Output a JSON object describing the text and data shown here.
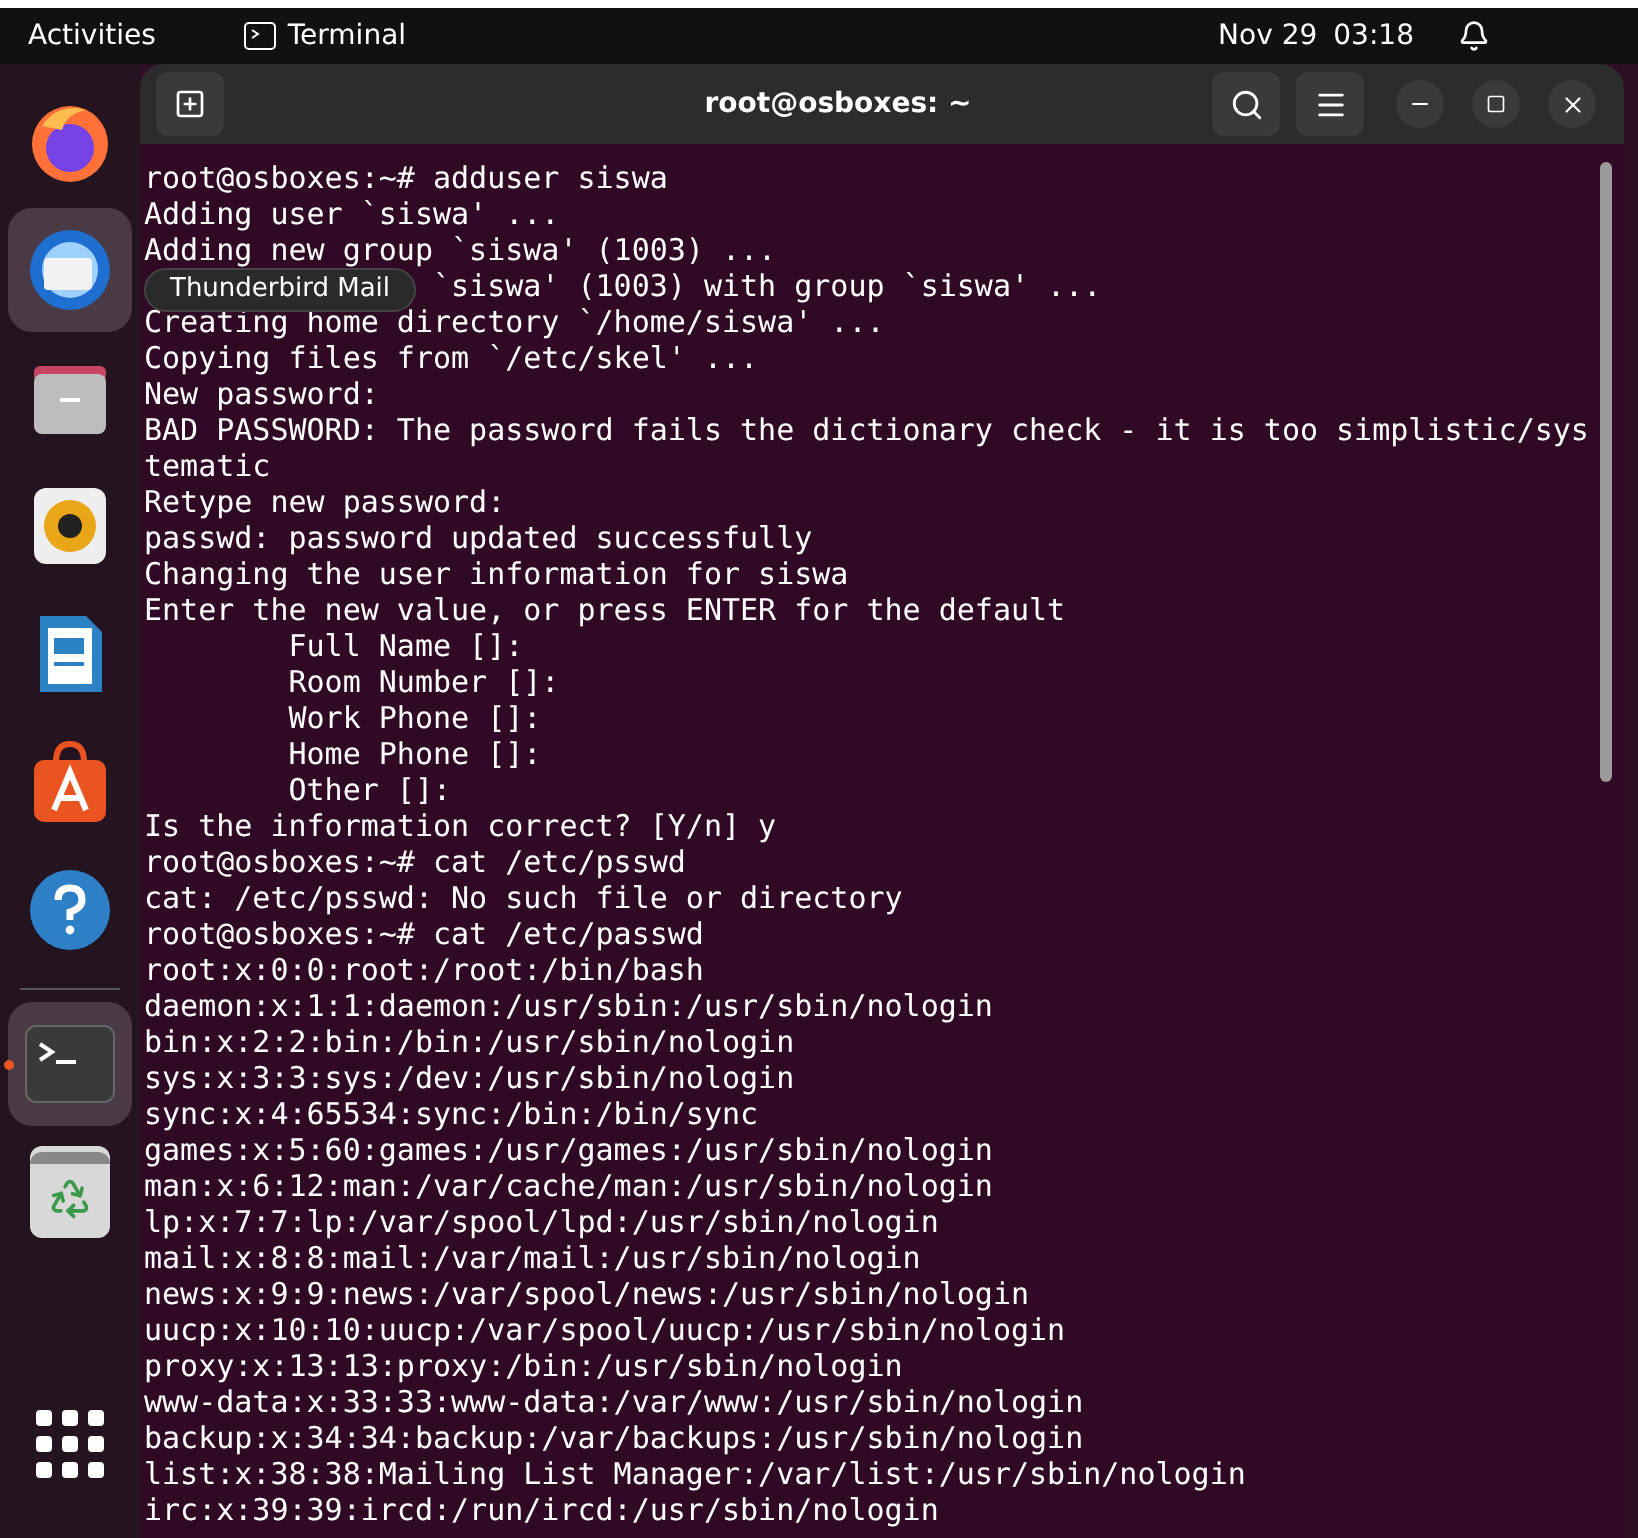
{
  "top_bar": {
    "activities": "Activities",
    "app": "Terminal",
    "date": "Nov 29",
    "time": "03:18"
  },
  "dock": {
    "items": [
      {
        "kind": "firefox",
        "running": false,
        "selected": false
      },
      {
        "kind": "mail",
        "running": false,
        "selected": true
      },
      {
        "kind": "files",
        "running": false,
        "selected": false
      },
      {
        "kind": "music",
        "running": false,
        "selected": false
      },
      {
        "kind": "writer",
        "running": false,
        "selected": false
      },
      {
        "kind": "store",
        "running": false,
        "selected": false
      },
      {
        "kind": "help",
        "running": false,
        "selected": false
      },
      {
        "kind": "terminal",
        "running": true,
        "selected": true
      },
      {
        "kind": "trash",
        "running": false,
        "selected": false
      },
      {
        "kind": "apps",
        "running": false,
        "selected": false
      }
    ],
    "tooltip": "Thunderbird Mail"
  },
  "window": {
    "title": "root@osboxes: ~"
  },
  "terminal": {
    "lines": [
      {
        "kind": "full",
        "text": "root@osboxes:~# adduser siswa"
      },
      {
        "kind": "full",
        "text": "Adding user `siswa' ..."
      },
      {
        "kind": "full",
        "text": "Adding new group `siswa' (1003) ..."
      },
      {
        "kind": "partial",
        "text": "`siswa' (1003) with group `siswa' ..."
      },
      {
        "kind": "full",
        "text": "Creating home directory `/home/siswa' ..."
      },
      {
        "kind": "full",
        "text": "Copying files from `/etc/skel' ..."
      },
      {
        "kind": "full",
        "text": "New password:"
      },
      {
        "kind": "full",
        "text": "BAD PASSWORD: The password fails the dictionary check - it is too simplistic/sys"
      },
      {
        "kind": "full",
        "text": "tematic"
      },
      {
        "kind": "full",
        "text": "Retype new password:"
      },
      {
        "kind": "full",
        "text": "passwd: password updated successfully"
      },
      {
        "kind": "full",
        "text": "Changing the user information for siswa"
      },
      {
        "kind": "full",
        "text": "Enter the new value, or press ENTER for the default"
      },
      {
        "kind": "full",
        "text": "        Full Name []:"
      },
      {
        "kind": "full",
        "text": "        Room Number []:"
      },
      {
        "kind": "full",
        "text": "        Work Phone []:"
      },
      {
        "kind": "full",
        "text": "        Home Phone []:"
      },
      {
        "kind": "full",
        "text": "        Other []:"
      },
      {
        "kind": "full",
        "text": "Is the information correct? [Y/n] y"
      },
      {
        "kind": "full",
        "text": "root@osboxes:~# cat /etc/psswd"
      },
      {
        "kind": "full",
        "text": "cat: /etc/psswd: No such file or directory"
      },
      {
        "kind": "full",
        "text": "root@osboxes:~# cat /etc/passwd"
      },
      {
        "kind": "full",
        "text": "root:x:0:0:root:/root:/bin/bash"
      },
      {
        "kind": "full",
        "text": "daemon:x:1:1:daemon:/usr/sbin:/usr/sbin/nologin"
      },
      {
        "kind": "full",
        "text": "bin:x:2:2:bin:/bin:/usr/sbin/nologin"
      },
      {
        "kind": "full",
        "text": "sys:x:3:3:sys:/dev:/usr/sbin/nologin"
      },
      {
        "kind": "full",
        "text": "sync:x:4:65534:sync:/bin:/bin/sync"
      },
      {
        "kind": "full",
        "text": "games:x:5:60:games:/usr/games:/usr/sbin/nologin"
      },
      {
        "kind": "full",
        "text": "man:x:6:12:man:/var/cache/man:/usr/sbin/nologin"
      },
      {
        "kind": "full",
        "text": "lp:x:7:7:lp:/var/spool/lpd:/usr/sbin/nologin"
      },
      {
        "kind": "full",
        "text": "mail:x:8:8:mail:/var/mail:/usr/sbin/nologin"
      },
      {
        "kind": "full",
        "text": "news:x:9:9:news:/var/spool/news:/usr/sbin/nologin"
      },
      {
        "kind": "full",
        "text": "uucp:x:10:10:uucp:/var/spool/uucp:/usr/sbin/nologin"
      },
      {
        "kind": "full",
        "text": "proxy:x:13:13:proxy:/bin:/usr/sbin/nologin"
      },
      {
        "kind": "full",
        "text": "www-data:x:33:33:www-data:/var/www:/usr/sbin/nologin"
      },
      {
        "kind": "full",
        "text": "backup:x:34:34:backup:/var/backups:/usr/sbin/nologin"
      },
      {
        "kind": "full",
        "text": "list:x:38:38:Mailing List Manager:/var/list:/usr/sbin/nologin"
      },
      {
        "kind": "full",
        "text": "irc:x:39:39:ircd:/run/ircd:/usr/sbin/nologin"
      }
    ]
  }
}
